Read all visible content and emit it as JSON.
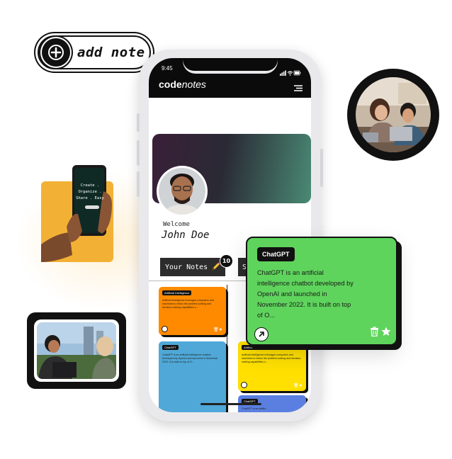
{
  "add_note": {
    "label": "add note"
  },
  "phone": {
    "status_time": "9:45",
    "brand": {
      "bold": "code",
      "light": "notes"
    },
    "welcome_label": "Welcome",
    "user_name": "John Doe",
    "your_notes_label": "Your Notes",
    "notes_count": "10",
    "second_tab_label": "S",
    "notes": [
      {
        "tag": "Artificial Intelligence",
        "text": "Artificial intelligence leverages computers and machines to mimic the problem-solving and decision-making capabilities o...",
        "color": "#ff8a00"
      },
      {
        "tag": "ChatGPT",
        "text": "ChatGPT is an artificial intelligence chatbot developed by OpenAI and launched in November 2022. It is built on top of O...",
        "color": "#4fa8d8"
      },
      {
        "tag": "Artificial Intelligence",
        "text": "Artificial intelligence leverages computers and machines to mimic the problem-solving and decision-making capabilities o...",
        "color": "#ffe000"
      },
      {
        "tag": "ChatGPT",
        "text": "ChatGPT is an artifici...",
        "color": "#5b7fe0"
      }
    ]
  },
  "featured_note": {
    "tag": "ChatGPT",
    "text": "ChatGPT is an artificial intelligence chatbot developed by OpenAI and launched in November 2022. It is built on top of O...",
    "color": "#5ed45c"
  },
  "hand_phone_text": "Create . Organize . Share . Easy",
  "icons": [
    "plus-icon",
    "signal-icon",
    "wifi-icon",
    "battery-icon",
    "menu-icon",
    "pencil-icon",
    "arrow-up-right-icon",
    "trash-icon",
    "star-icon"
  ]
}
